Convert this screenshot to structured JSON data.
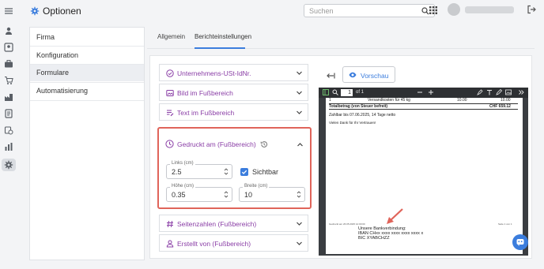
{
  "header": {
    "title": "Optionen",
    "search_placeholder": "Suchen"
  },
  "nav": {
    "items": [
      "Firma",
      "Konfiguration",
      "Formulare",
      "Automatisierung"
    ],
    "active": "Formulare"
  },
  "tabs": {
    "items": [
      "Allgemein",
      "Berichteinstellungen"
    ],
    "active": "Berichteinstellungen"
  },
  "accordion": {
    "item_ust": "Unternehmens-USt-IdNr.",
    "item_bild": "Bild im Fußbereich",
    "item_text": "Text im Fußbereich",
    "item_gedruckt": "Gedruckt am (Fußbereich)",
    "item_seitenzahlen": "Seitenzahlen (Fußbereich)",
    "item_erstellt": "Erstellt von (Fußbereich)"
  },
  "gedruckt": {
    "links_label": "Links (cm)",
    "links_value": "2.5",
    "hoehe_label": "Höhe (cm)",
    "hoehe_value": "0.35",
    "breite_label": "Breite (cm)",
    "breite_value": "10",
    "sichtbar_label": "Sichtbar",
    "sichtbar_checked": true
  },
  "preview": {
    "button_label": "Vorschau",
    "page_number": "1",
    "page_of": "of 1",
    "doc": {
      "row1_label": "Versandkosten für 45 kg",
      "row1_val1": "10.00",
      "row1_val2": "10.00",
      "total_label": "Totalbetrag (von Steuer befreit)",
      "total_value": "CHF 659.12",
      "zahlbar": "Zahlbar bis 07.06.2025, 14 Tage netto",
      "dank": "Vielen Dank für Ihr Vertrauen!",
      "printed_small": "Gedruckt am 26.05.2025 12:00:00",
      "page_small": "Seite 1 von 1",
      "bank_title": "Unsere Bankverbindung:",
      "iban": "IBAN CHxx xxxx xxxx xxxx xxxx x",
      "bic": "BIC XYABCHZZ"
    }
  },
  "colors": {
    "accent": "#3b7ddd",
    "purple": "#8a3ea6",
    "highlight": "#e0645a"
  }
}
